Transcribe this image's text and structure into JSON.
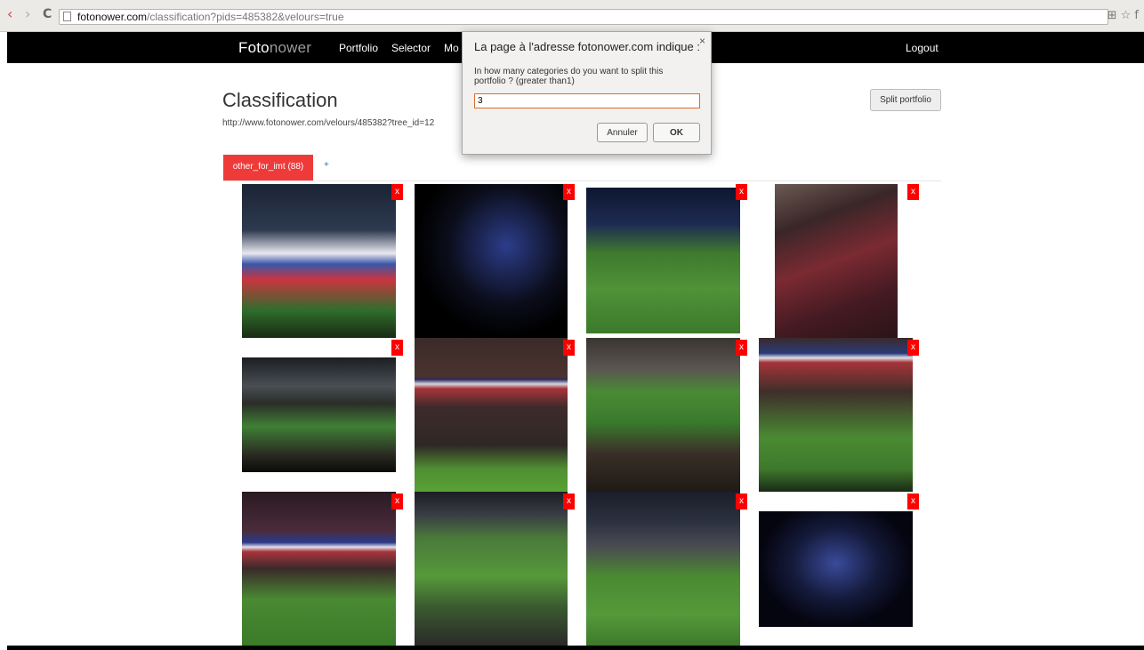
{
  "browser": {
    "back_icon": "‹",
    "forward_icon": "›",
    "reload_icon": "C",
    "url_host": "fotonower.com",
    "url_path": "/classification?pids=485382&velours=true",
    "right_icons": "⊞ ☆ f"
  },
  "nav": {
    "brand_part1": "Foto",
    "brand_part2": "nower",
    "links": [
      "Portfolio",
      "Selector",
      "Mo"
    ],
    "logout": "Logout"
  },
  "page": {
    "title": "Classification",
    "url": "http://www.fotonower.com/velours/485382?tree_id=12",
    "split_button": "Split portfolio",
    "tab_label": "other_for_imt (88)",
    "tab_add": "+"
  },
  "photos": {
    "delete_label": "x",
    "items": [
      {
        "desc": "stadium crowd flag"
      },
      {
        "desc": "wembley arch night"
      },
      {
        "desc": "player celebration"
      },
      {
        "desc": "crowd stands red"
      },
      {
        "desc": "stadium pitch wide"
      },
      {
        "desc": "crowd teams lineup"
      },
      {
        "desc": "crowd pitch lineup"
      },
      {
        "desc": "stands flag lineup"
      },
      {
        "desc": "teams lineup banner"
      },
      {
        "desc": "pitch flag center"
      },
      {
        "desc": "stadium lineup"
      },
      {
        "desc": "wembley arch exterior"
      }
    ]
  },
  "dialog": {
    "title": "La page à l'adresse fotonower.com indique :",
    "close": "×",
    "message": "In how many categories do you want to split this portfolio ? (greater than1)",
    "input_value": "3",
    "cancel": "Annuler",
    "ok": "OK"
  }
}
